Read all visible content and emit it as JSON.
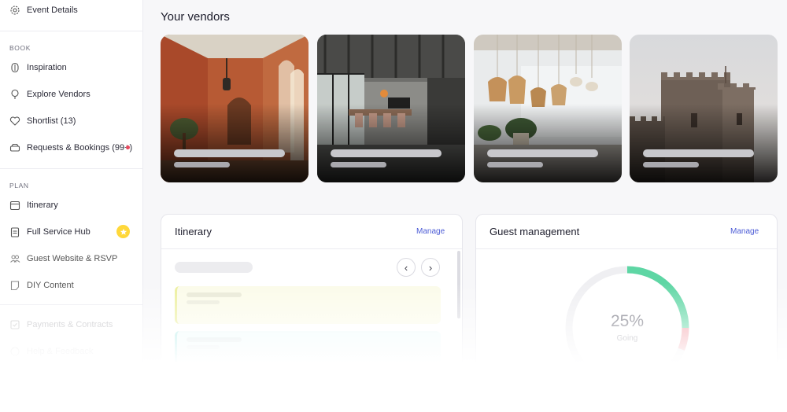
{
  "sidebar": {
    "top_item": {
      "label": "Event Details",
      "icon": "gear-icon"
    },
    "book_section_label": "BOOK",
    "book_items": [
      {
        "label": "Inspiration",
        "icon": "lightbulb-icon"
      },
      {
        "label": "Explore Vendors",
        "icon": "pin-icon"
      },
      {
        "label": "Shortlist (13)",
        "icon": "heart-icon"
      },
      {
        "label": "Requests & Bookings (99+)",
        "icon": "car-icon"
      }
    ],
    "plan_section_label": "PLAN",
    "plan_items": [
      {
        "label": "Itinerary",
        "icon": "calendar-icon"
      },
      {
        "label": "Full Service Hub",
        "icon": "clipboard-icon"
      },
      {
        "label": "Guest Website & RSVP",
        "icon": "guests-icon"
      },
      {
        "label": "DIY Content",
        "icon": "note-icon"
      }
    ],
    "more_items": [
      {
        "label": "Payments & Contracts",
        "icon": "checkbox-icon"
      },
      {
        "label": "Help & Feedback",
        "icon": "help-icon"
      }
    ],
    "notification_color": "#e84a5f",
    "badge_color": "#ffd83a"
  },
  "main": {
    "vendors_title": "Your vendors",
    "vendors": [
      {
        "image": "terracotta-corridor-photo"
      },
      {
        "image": "loft-dining-room-photo"
      },
      {
        "image": "rattan-pendant-lights-photo"
      },
      {
        "image": "stone-castle-tower-photo"
      }
    ],
    "itinerary": {
      "title": "Itinerary",
      "manage_label": "Manage",
      "prev_icon": "‹",
      "next_icon": "›"
    },
    "guests": {
      "title": "Guest management",
      "manage_label": "Manage",
      "percent_label": "25%",
      "percent_value": 25,
      "status_label": "Going"
    }
  },
  "colors": {
    "accent": "#4b5bd6",
    "going": "#5ed6a4",
    "declined": "#f29aa3"
  }
}
